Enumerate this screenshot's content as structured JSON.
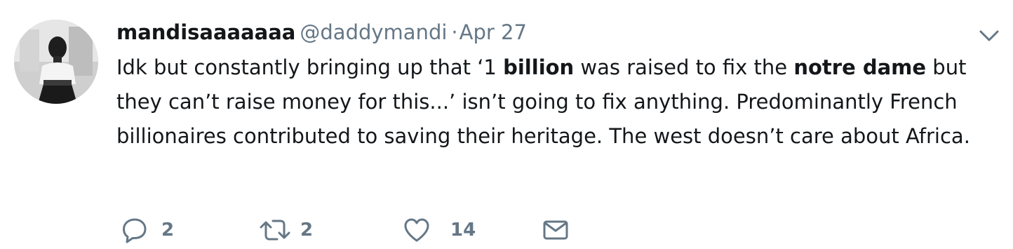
{
  "tweet": {
    "user": {
      "display_name": "mandisaaaaaaa",
      "handle": "@daddymandi"
    },
    "separator": "·",
    "date": "Apr 27",
    "text_segments": [
      {
        "text": "Idk but constantly bringing up that ‘1 ",
        "bold": false
      },
      {
        "text": "billion",
        "bold": true
      },
      {
        "text": " was raised to fix the ",
        "bold": false
      },
      {
        "text": "notre dame",
        "bold": true
      },
      {
        "text": " but they can’t raise money for this...’ isn’t going to fix anything. Predominantly French billionaires contributed to saving their heritage. The west doesn’t care about Africa.",
        "bold": false
      }
    ],
    "actions": {
      "reply": {
        "icon": "reply-icon",
        "count": "2"
      },
      "retweet": {
        "icon": "retweet-icon",
        "count": "2"
      },
      "like": {
        "icon": "heart-icon",
        "count": "14"
      },
      "message": {
        "icon": "envelope-icon"
      }
    },
    "menu_icon": "chevron-down-icon"
  },
  "colors": {
    "text": "#14171a",
    "secondary": "#657786"
  }
}
